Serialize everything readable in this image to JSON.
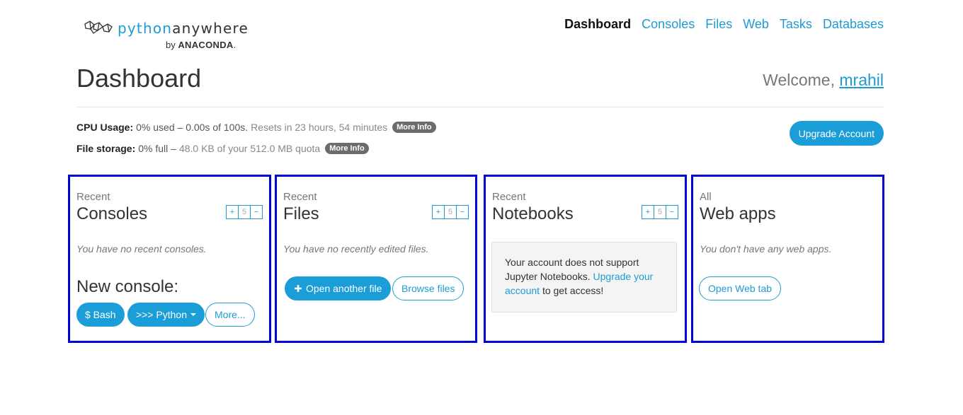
{
  "brand": {
    "word1": "python",
    "word2": "anywhere",
    "by": "by",
    "company": "ANACONDA",
    "company_suffix": "."
  },
  "nav": {
    "items": [
      {
        "label": "Dashboard",
        "active": true
      },
      {
        "label": "Consoles"
      },
      {
        "label": "Files"
      },
      {
        "label": "Web"
      },
      {
        "label": "Tasks"
      },
      {
        "label": "Databases"
      }
    ]
  },
  "page": {
    "title": "Dashboard",
    "welcome_prefix": "Welcome,",
    "username": "mrahil"
  },
  "usage": {
    "cpu_label": "CPU Usage:",
    "cpu_value": "0% used – 0.00s of 100s.",
    "cpu_reset": "Resets in 23 hours, 54 minutes",
    "storage_label": "File storage:",
    "storage_value": "0% full –",
    "storage_detail": "48.0 KB of your 512.0 MB quota",
    "more_info": "More Info"
  },
  "upgrade_label": "Upgrade Account",
  "panels": {
    "consoles": {
      "small": "Recent",
      "big": "Consoles",
      "count": "5",
      "empty": "You have no recent consoles.",
      "new_label": "New console:",
      "bash": "$ Bash",
      "python": ">>> Python",
      "more": "More..."
    },
    "files": {
      "small": "Recent",
      "big": "Files",
      "count": "5",
      "empty": "You have no recently edited files.",
      "open": "Open another file",
      "browse": "Browse files"
    },
    "notebooks": {
      "small": "Recent",
      "big": "Notebooks",
      "count": "5",
      "notice_text": "Your account does not support Jupyter Notebooks.",
      "notice_link": "Upgrade your account",
      "notice_tail": "to get access!"
    },
    "webapps": {
      "small": "All",
      "big": "Web apps",
      "empty": "You don't have any web apps.",
      "open": "Open Web tab"
    }
  },
  "stepper": {
    "plus": "+",
    "minus": "−"
  },
  "colors": {
    "accent": "#1f9bd3",
    "button": "#1b9dd8",
    "panel_border": "#0000d8",
    "pill": "#6c6c6c"
  }
}
